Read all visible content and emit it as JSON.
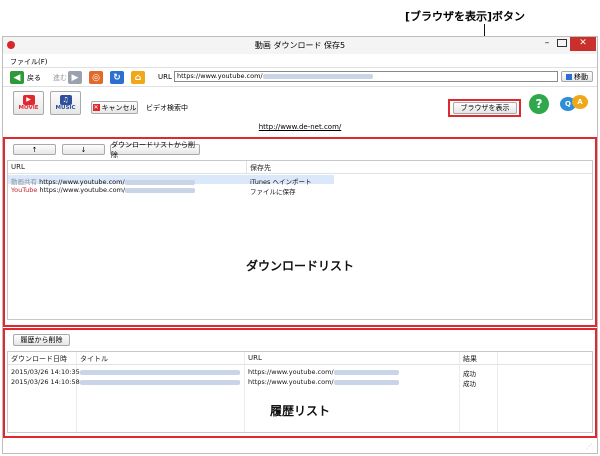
{
  "annotation": {
    "callout": "[ブラウザを表示]ボタン"
  },
  "window": {
    "title": "動画 ダウンロード 保存5",
    "menu_file": "ファイル(F)"
  },
  "toolbar": {
    "back": "戻る",
    "forward": "進む",
    "url_label": "URL",
    "url_value": "https://www.youtube.com/",
    "go": "移動"
  },
  "actions": {
    "movie": "MOVIE",
    "music": "MUSIC",
    "cancel": "キャンセル",
    "status": "ビデオ検索中",
    "show_browser": "ブラウザを表示",
    "site_link": "http://www.de-net.com/"
  },
  "download": {
    "up": "↑",
    "down": "↓",
    "remove": "ダウンロードリストから削除",
    "col_url": "URL",
    "col_dest": "保存先",
    "rows": [
      {
        "source": "動画共有",
        "url": "https://www.youtube.com/",
        "dest": "iTunes へインポート"
      },
      {
        "source": "YouTube",
        "url": "https://www.youtube.com/",
        "dest": "ファイルに保存"
      }
    ],
    "label": "ダウンロードリスト"
  },
  "history": {
    "remove": "履歴から削除",
    "col_date": "ダウンロード日時",
    "col_title": "タイトル",
    "col_url": "URL",
    "col_result": "結果",
    "rows": [
      {
        "date": "2015/03/26 14:10:35",
        "url": "https://www.youtube.com/",
        "result": "成功"
      },
      {
        "date": "2015/03/26 14:10:58",
        "url": "https://www.youtube.com/",
        "result": "成功"
      }
    ],
    "label": "履歴リスト"
  },
  "colors": {
    "accent": "#e0292f",
    "titlebar": "#f4f4f4"
  }
}
